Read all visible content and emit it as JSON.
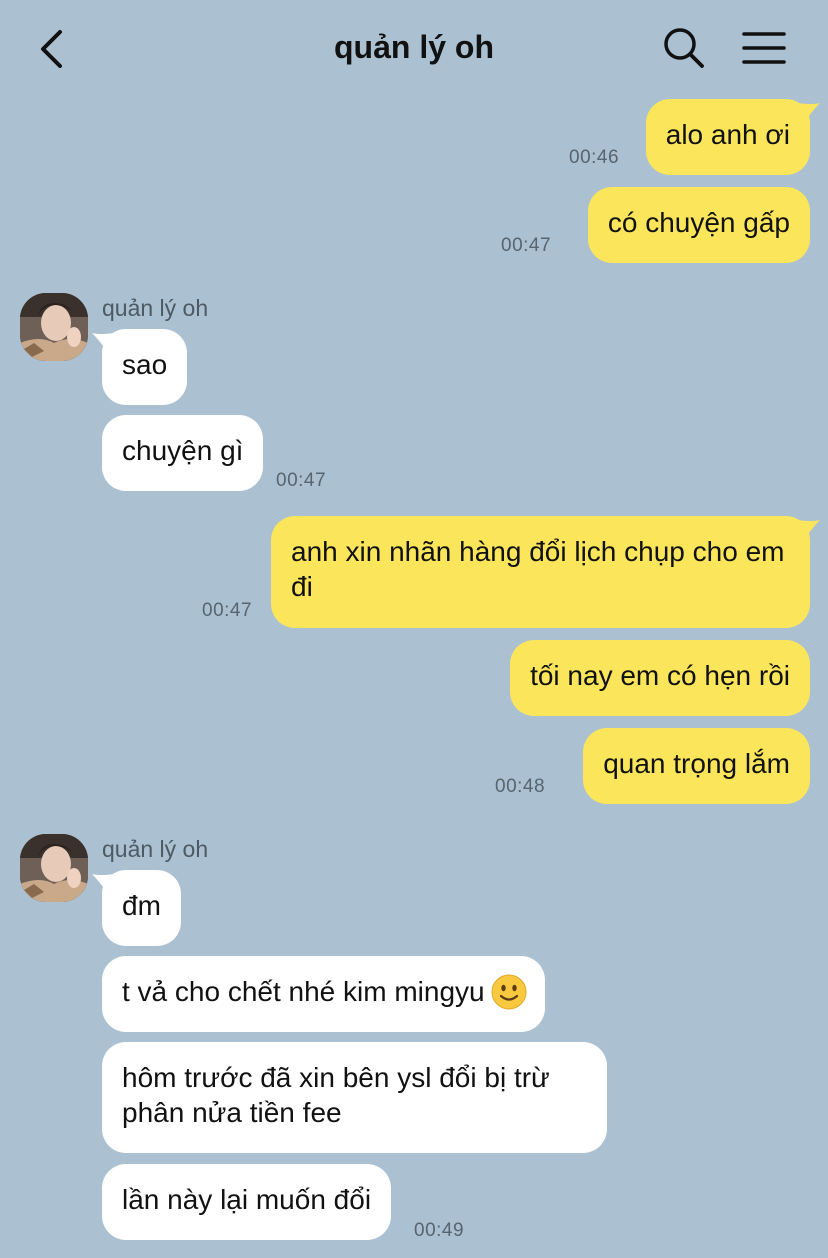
{
  "header": {
    "title": "quản lý oh",
    "back_icon": "chevron-left-icon",
    "search_icon": "search-icon",
    "menu_icon": "hamburger-menu-icon"
  },
  "colors": {
    "background": "#abc1d1",
    "my_bubble": "#fbe55a",
    "their_bubble": "#ffffff",
    "time_text": "#56656f"
  },
  "messages": [
    {
      "from": "me",
      "text": "alo anh ơi",
      "time": "00:46"
    },
    {
      "from": "me",
      "text": "có chuyện gấp",
      "time": "00:47"
    },
    {
      "from": "them",
      "sender": "quản lý oh",
      "text": "sao",
      "time": ""
    },
    {
      "from": "them",
      "text": "chuyện gì",
      "time": "00:47"
    },
    {
      "from": "me",
      "text": "anh xin nhãn hàng đổi lịch chụp cho em đi",
      "time": "00:47"
    },
    {
      "from": "me",
      "text": "tối nay em có hẹn rồi",
      "time": ""
    },
    {
      "from": "me",
      "text": "quan trọng lắm",
      "time": "00:48"
    },
    {
      "from": "them",
      "sender": "quản lý oh",
      "text": "đm",
      "time": ""
    },
    {
      "from": "them",
      "text": "t vả cho chết nhé kim mingyu",
      "emoji": "slightly-smiling-face-emoji",
      "time": ""
    },
    {
      "from": "them",
      "text": "hôm trước đã xin bên ysl đổi bị trừ phân nửa tiền fee",
      "time": ""
    },
    {
      "from": "them",
      "text": "lần này lại muốn đổi",
      "time": "00:49"
    }
  ]
}
